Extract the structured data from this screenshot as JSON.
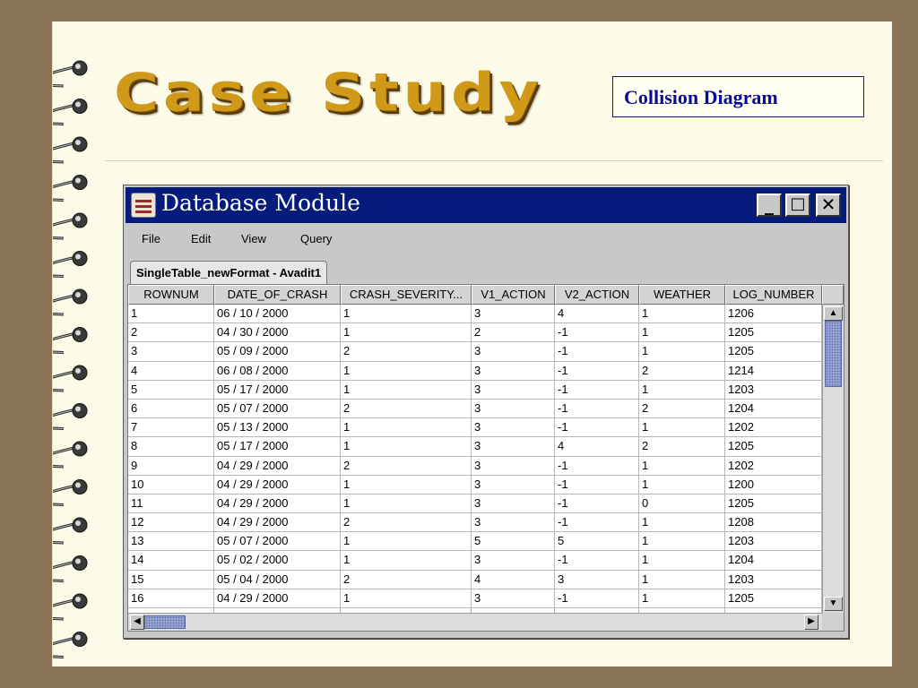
{
  "slide": {
    "title": "Case Study",
    "subtitle_box": "Collision Diagram"
  },
  "window": {
    "title": "Database Module",
    "controls": {
      "minimize": "_",
      "maximize": "□",
      "close": "✕"
    },
    "menu": [
      "File",
      "Edit",
      "View",
      "Query"
    ],
    "tab_label": "SingleTable_newFormat - Avadit1"
  },
  "table": {
    "columns": [
      "ROWNUM",
      "DATE_OF_CRASH",
      "CRASH_SEVERITY...",
      "V1_ACTION",
      "V2_ACTION",
      "WEATHER",
      "LOG_NUMBER"
    ],
    "rows": [
      [
        "1",
        "06 / 10 / 2000",
        "1",
        "3",
        "4",
        "1",
        "1206"
      ],
      [
        "2",
        "04 / 30 / 2000",
        "1",
        "2",
        "-1",
        "1",
        "1205"
      ],
      [
        "3",
        "05 / 09 / 2000",
        "2",
        "3",
        "-1",
        "1",
        "1205"
      ],
      [
        "4",
        "06 / 08 / 2000",
        "1",
        "3",
        "-1",
        "2",
        "1214"
      ],
      [
        "5",
        "05 / 17 / 2000",
        "1",
        "3",
        "-1",
        "1",
        "1203"
      ],
      [
        "6",
        "05 / 07 / 2000",
        "2",
        "3",
        "-1",
        "2",
        "1204"
      ],
      [
        "7",
        "05 / 13 / 2000",
        "1",
        "3",
        "-1",
        "1",
        "1202"
      ],
      [
        "8",
        "05 / 17 / 2000",
        "1",
        "3",
        "4",
        "2",
        "1205"
      ],
      [
        "9",
        "04 / 29 / 2000",
        "2",
        "3",
        "-1",
        "1",
        "1202"
      ],
      [
        "10",
        "04 / 29 / 2000",
        "1",
        "3",
        "-1",
        "1",
        "1200"
      ],
      [
        "11",
        "04 / 29 / 2000",
        "1",
        "3",
        "-1",
        "0",
        "1205"
      ],
      [
        "12",
        "04 / 29 / 2000",
        "2",
        "3",
        "-1",
        "1",
        "1208"
      ],
      [
        "13",
        "05 / 07 / 2000",
        "1",
        "5",
        "5",
        "1",
        "1203"
      ],
      [
        "14",
        "05 / 02 / 2000",
        "1",
        "3",
        "-1",
        "1",
        "1204"
      ],
      [
        "15",
        "05 / 04 / 2000",
        "2",
        "4",
        "3",
        "1",
        "1203"
      ],
      [
        "16",
        "04 / 29 / 2000",
        "1",
        "3",
        "-1",
        "1",
        "1205"
      ]
    ]
  },
  "icons": {
    "spiral": "spiral-binding",
    "app": "coffee-cup-icon",
    "scroll_up": "▲",
    "scroll_down": "▼",
    "scroll_left": "◀",
    "scroll_right": "▶"
  },
  "colors": {
    "background": "#8b7357",
    "page": "#fbfbe8",
    "title": "#d09a18",
    "titlebar": "#061c7c",
    "subtitle_text": "#0a0a9a"
  }
}
